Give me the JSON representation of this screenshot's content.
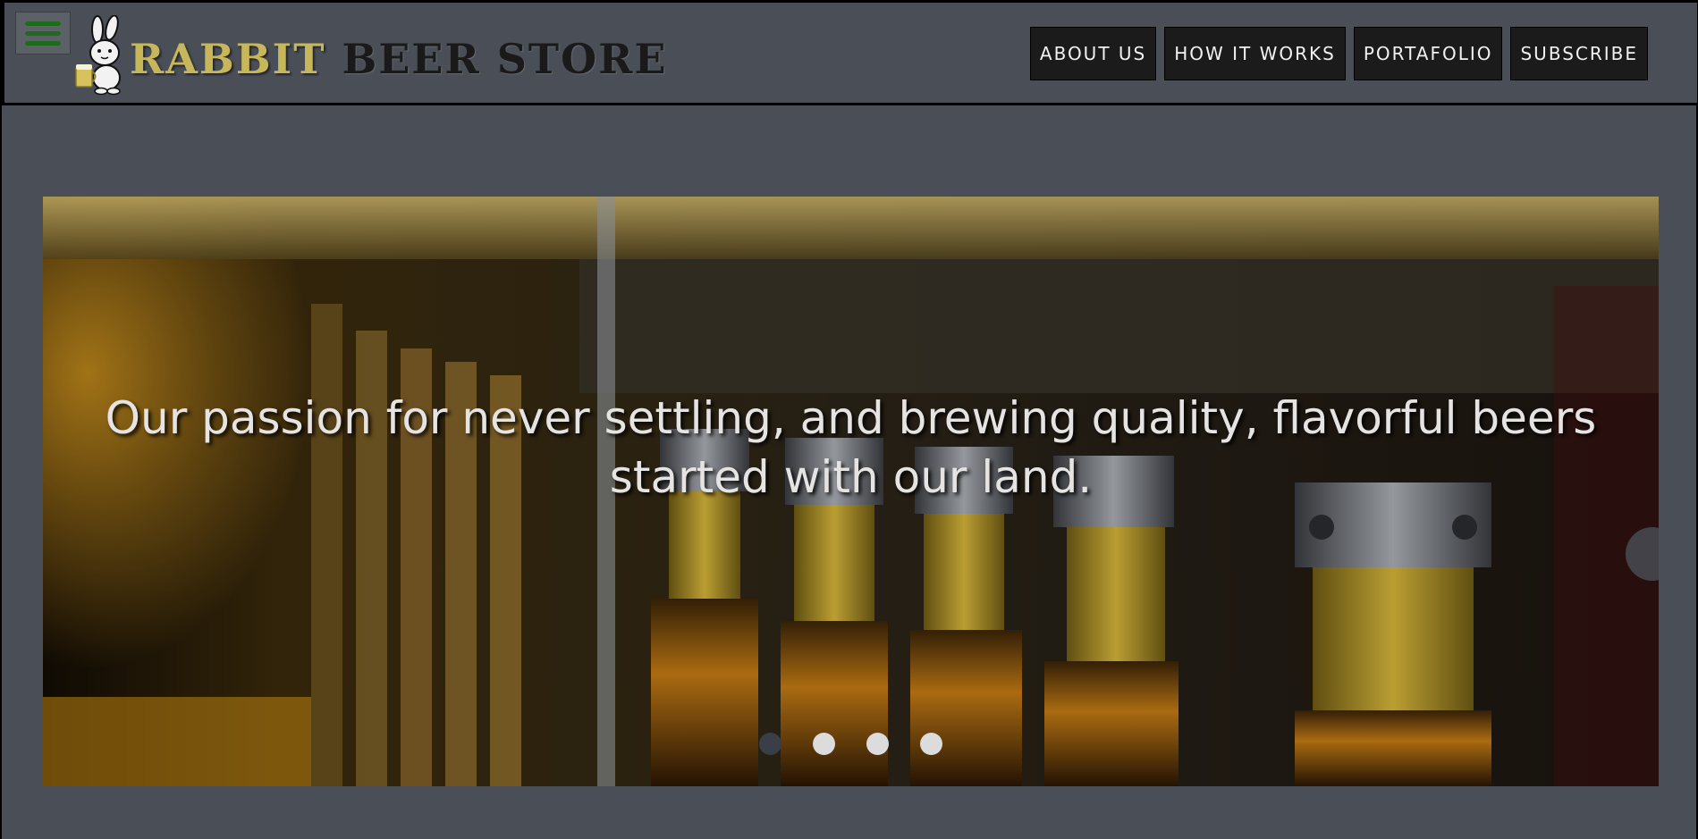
{
  "header": {
    "brand_part1": "RABBIT",
    "brand_part2": "BEER STORE",
    "logo_icon": "rabbit-beer-logo-icon",
    "menu_icon": "hamburger-menu-icon"
  },
  "nav": {
    "items": [
      {
        "label": "ABOUT US"
      },
      {
        "label": "HOW IT WORKS"
      },
      {
        "label": "PORTAFOLIO"
      },
      {
        "label": "SUBSCRIBE"
      }
    ]
  },
  "hero": {
    "caption": "Our passion for never settling, and brewing quality, flavorful beers started with our land.",
    "slides_count": 4,
    "active_slide": 1
  },
  "colors": {
    "background": "#4a4f57",
    "menu_icon": "#1f6b1c",
    "brand_gold": "#c8b65a",
    "nav_button": "#1b1b1b"
  }
}
